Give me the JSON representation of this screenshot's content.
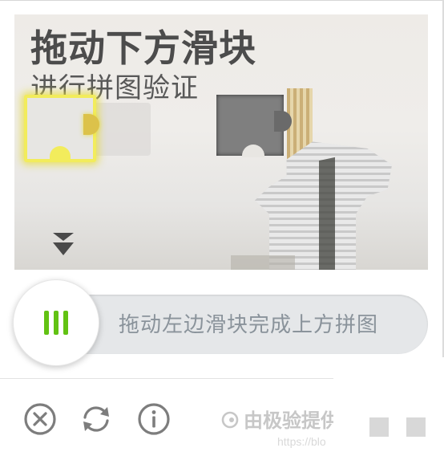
{
  "captcha": {
    "headline": "拖动下方滑块",
    "subline": "进行拼图验证",
    "hint_icon": "double-chevron-down-icon"
  },
  "slider": {
    "label": "拖动左边滑块完成上方拼图",
    "handle_icon": "grip-icon",
    "accent_color": "#62c213",
    "track_color": "#e5e7e9"
  },
  "footer": {
    "close_icon": "close-icon",
    "refresh_icon": "refresh-icon",
    "info_icon": "info-icon",
    "provided_by": "由极验提供",
    "provider_url": "https://blo"
  }
}
